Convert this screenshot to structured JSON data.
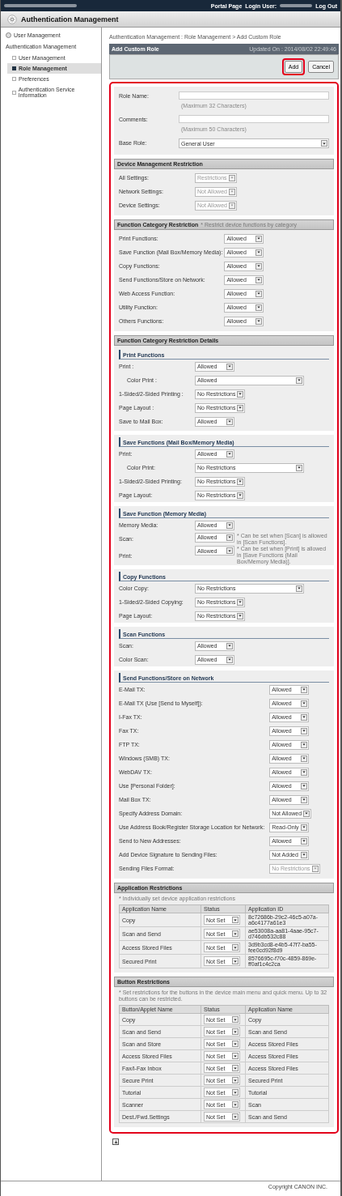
{
  "top_bar": {
    "portal": "Portal Page",
    "login_label": "Login User:",
    "logout": "Log Out"
  },
  "header": {
    "title": "Authentication Management"
  },
  "sidebar": {
    "items": [
      {
        "label": "User Management",
        "kind": "link",
        "selected": false
      },
      {
        "label": "Authentication Management",
        "kind": "heading"
      },
      {
        "label": "User Management",
        "kind": "sub",
        "selected": false
      },
      {
        "label": "Role Management",
        "kind": "sub",
        "selected": true
      },
      {
        "label": "Preferences",
        "kind": "sub",
        "selected": false
      },
      {
        "label": "Authentication Service Information",
        "kind": "sub",
        "selected": false
      }
    ]
  },
  "breadcrumb": "Authentication Management : Role Management > Add Custom Role",
  "panel": {
    "title": "Add Custom Role",
    "updated_label": "Updated On :",
    "updated_value": "2014/08/02 22:49:46",
    "buttons": [
      {
        "label": "Add",
        "highlighted": true
      },
      {
        "label": "Cancel",
        "highlighted": false
      }
    ]
  },
  "basic_fields": [
    {
      "label": "Role Name:",
      "kind": "text",
      "hint": "(Maximum 32 Characters)"
    },
    {
      "label": "Comments:",
      "kind": "text",
      "hint": "(Maximum 50 Characters)"
    },
    {
      "label": "Base Role:",
      "kind": "select",
      "value": "General User"
    }
  ],
  "sections": [
    {
      "kind": "fields",
      "title": "Device Management Restriction",
      "rows": [
        {
          "label": "All Settings:",
          "value": "Restrictions",
          "disabled": true
        },
        {
          "label": "Network Settings:",
          "value": "Not Allowed",
          "disabled": true
        },
        {
          "label": "Device Settings:",
          "value": "Not Allowed",
          "disabled": true
        }
      ]
    },
    {
      "kind": "fields",
      "title": "Function Category Restriction",
      "note": "* Restrict device functions by category",
      "rows": [
        {
          "label": "Print Functions:",
          "value": "Allowed",
          "disabled": false
        },
        {
          "label": "Save Function (Mail Box/Memory Media):",
          "value": "Allowed",
          "disabled": false
        },
        {
          "label": "Copy Functions:",
          "value": "Allowed",
          "disabled": false
        },
        {
          "label": "Send Functions/Store on Network:",
          "value": "Allowed",
          "disabled": false
        },
        {
          "label": "Web Access Function:",
          "value": "Allowed",
          "disabled": false
        },
        {
          "label": "Utility Function:",
          "value": "Allowed",
          "disabled": false
        },
        {
          "label": "Others Functions:",
          "value": "Allowed",
          "disabled": false
        }
      ]
    },
    {
      "kind": "details",
      "title": "Function Category Restriction Details",
      "groups": [
        {
          "title": "Print Functions",
          "rows": [
            {
              "label": "Print :",
              "value": "Allowed",
              "disabled": false,
              "indent": false,
              "wide": false
            },
            {
              "label": "Color Print :",
              "value": "Allowed",
              "disabled": false,
              "indent": true,
              "wide": true
            },
            {
              "label": "1-Sided/2-Sided Printing :",
              "value": "No Restrictions",
              "disabled": false,
              "indent": false,
              "wide": false
            },
            {
              "label": "Page Layout :",
              "value": "No Restrictions",
              "disabled": false,
              "indent": false,
              "wide": false
            },
            {
              "label": "Save to Mail Box:",
              "value": "Allowed",
              "disabled": false,
              "indent": false,
              "wide": false
            }
          ]
        },
        {
          "title": "Save Functions (Mail Box/Memory Media)",
          "rows": [
            {
              "label": "Print:",
              "value": "Allowed",
              "disabled": false,
              "indent": false,
              "wide": false
            },
            {
              "label": "Color Print:",
              "value": "No Restrictions",
              "disabled": false,
              "indent": true,
              "wide": true
            },
            {
              "label": "1-Sided/2-Sided Printing:",
              "value": "No Restrictions",
              "disabled": false,
              "indent": false,
              "wide": false
            },
            {
              "label": "Page Layout:",
              "value": "No Restrictions",
              "disabled": false,
              "indent": false,
              "wide": false
            }
          ]
        },
        {
          "title": "Save Function (Memory Media)",
          "rows": [
            {
              "label": "Memory Media:",
              "value": "Allowed",
              "disabled": false,
              "indent": false,
              "wide": false
            },
            {
              "label": "Scan:",
              "value": "Allowed",
              "disabled": false,
              "indent": false,
              "wide": false,
              "note": "* Can be set when [Scan] is allowed in [Scan Functions]."
            },
            {
              "label": "Print:",
              "value": "Allowed",
              "disabled": false,
              "indent": false,
              "wide": false,
              "note": "* Can be set when [Print] is allowed in [Save Functions (Mail Box/Memory Media)]."
            }
          ]
        },
        {
          "title": "Copy Functions",
          "rows": [
            {
              "label": "Color Copy:",
              "value": "No Restrictions",
              "disabled": false,
              "indent": false,
              "wide": true
            },
            {
              "label": "1-Sided/2-Sided Copying:",
              "value": "No Restrictions",
              "disabled": false,
              "indent": false,
              "wide": false
            },
            {
              "label": "Page Layout:",
              "value": "No Restrictions",
              "disabled": false,
              "indent": false,
              "wide": false
            }
          ]
        },
        {
          "title": "Scan Functions",
          "rows": [
            {
              "label": "Scan:",
              "value": "Allowed",
              "disabled": false,
              "indent": false,
              "wide": false
            },
            {
              "label": "Color Scan:",
              "value": "Allowed",
              "disabled": false,
              "indent": false,
              "wide": false
            }
          ]
        },
        {
          "title": "Send Functions/Store on Network",
          "rows": [
            {
              "label": "E-Mail TX:",
              "value": "Allowed",
              "disabled": false,
              "indent": false,
              "wide": false
            },
            {
              "label": "E-Mail TX (Use [Send to Myself]):",
              "value": "Allowed",
              "disabled": false,
              "indent": false,
              "wide": false
            },
            {
              "label": "I-Fax TX:",
              "value": "Allowed",
              "disabled": false,
              "indent": false,
              "wide": false
            },
            {
              "label": "Fax TX:",
              "value": "Allowed",
              "disabled": false,
              "indent": false,
              "wide": false
            },
            {
              "label": "FTP TX:",
              "value": "Allowed",
              "disabled": false,
              "indent": false,
              "wide": false
            },
            {
              "label": "Windows (SMB) TX:",
              "value": "Allowed",
              "disabled": false,
              "indent": false,
              "wide": false
            },
            {
              "label": "WebDAV TX:",
              "value": "Allowed",
              "disabled": false,
              "indent": false,
              "wide": false
            },
            {
              "label": "Use [Personal Folder]:",
              "value": "Allowed",
              "disabled": false,
              "indent": false,
              "wide": false
            },
            {
              "label": "Mail Box TX:",
              "value": "Allowed",
              "disabled": false,
              "indent": false,
              "wide": false
            },
            {
              "label": "Specify Address Domain:",
              "value": "Not Allowed",
              "disabled": false,
              "indent": false,
              "wide": false
            },
            {
              "label": "Use Address Book/Register Storage Location for Network:",
              "value": "Read-Only",
              "disabled": false,
              "indent": false,
              "wide": false
            },
            {
              "label": "Send to New Addresses:",
              "value": "Allowed",
              "disabled": false,
              "indent": false,
              "wide": false
            },
            {
              "label": "Add Device Signature to Sending Files:",
              "value": "Not Added",
              "disabled": false,
              "indent": false,
              "wide": false
            },
            {
              "label": "Sending Files Format:",
              "value": "No Restrictions",
              "disabled": true,
              "indent": false,
              "wide": false
            }
          ]
        }
      ]
    },
    {
      "kind": "table",
      "title": "Application Restrictions",
      "note": "* Individually set device application restrictions",
      "columns": [
        "Application Name",
        "Status",
        "Application ID"
      ],
      "rows": [
        [
          "Copy",
          "Not Set",
          "8c72686b-29c2-46c5-a07a-a6c4177a61e3"
        ],
        [
          "Scan and Send",
          "Not Set",
          "ae53008a-aa81-4aae-95c7-d746db532c88"
        ],
        [
          "Access Stored Files",
          "Not Set",
          "3d9b3cd8-e4b5-47f7-ba55-fee0cd92f8d9"
        ],
        [
          "Secured Print",
          "Not Set",
          "8576695c-f70c-4859-869e-ff0af1c4c2ca"
        ]
      ]
    },
    {
      "kind": "table",
      "title": "Button Restrictions",
      "note": "* Set restrictions for the buttons in the device main menu and quick menu. Up to 32 buttons can be restricted.",
      "columns": [
        "Button/Applet Name",
        "Status",
        "Application Name"
      ],
      "rows": [
        [
          "Copy",
          "Not Set",
          "Copy"
        ],
        [
          "Scan and Send",
          "Not Set",
          "Scan and Send"
        ],
        [
          "Scan and Store",
          "Not Set",
          "Access Stored Files"
        ],
        [
          "Access Stored Files",
          "Not Set",
          "Access Stored Files"
        ],
        [
          "Fax/I-Fax Inbox",
          "Not Set",
          "Access Stored Files"
        ],
        [
          "Secure Print",
          "Not Set",
          "Secured Print"
        ],
        [
          "Tutorial",
          "Not Set",
          "Tutorial"
        ],
        [
          "Scanner",
          "Not Set",
          "Scan"
        ],
        [
          "Dest./Fwd.Settings",
          "Not Set",
          "Scan and Send"
        ]
      ]
    }
  ],
  "footer": {
    "copyright": "Copyright CANON INC."
  }
}
